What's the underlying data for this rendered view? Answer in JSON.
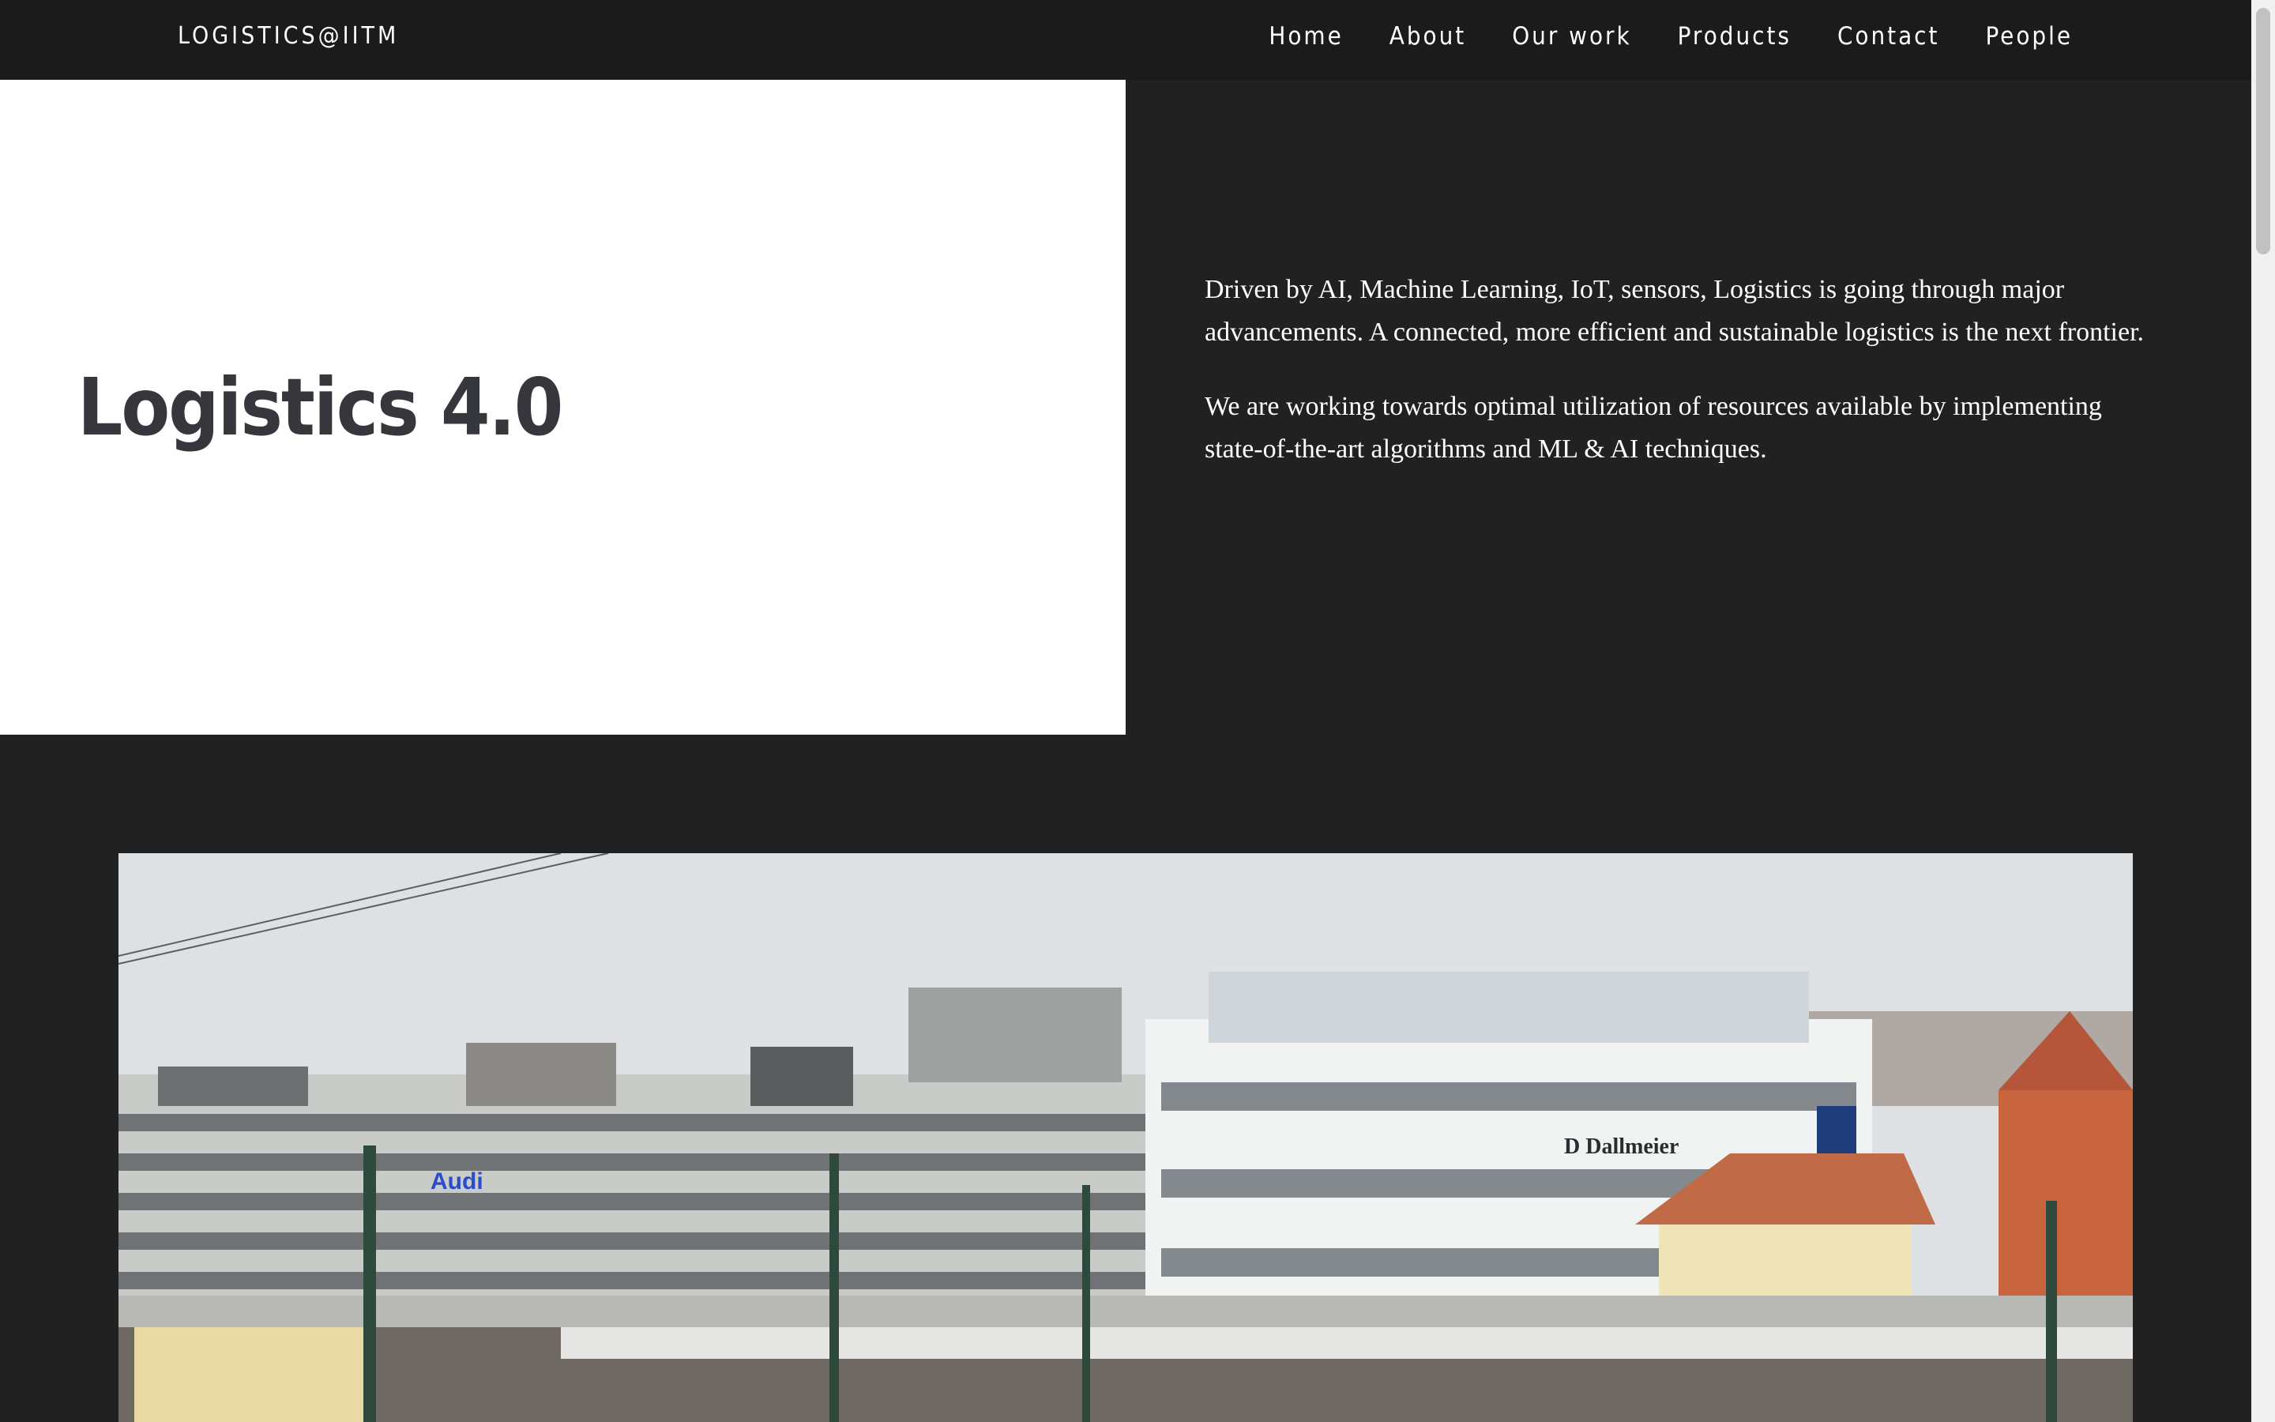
{
  "brand": "LOGISTICS@IITM",
  "nav": {
    "items": [
      "Home",
      "About",
      "Our work",
      "Products",
      "Contact",
      "People"
    ]
  },
  "hero": {
    "title": "Logistics 4.0",
    "paragraph1": "Driven by AI, Machine Learning, IoT, sensors, Logistics is going through major advancements. A connected, more efficient and sustainable logistics is the next frontier.",
    "paragraph2": "We are working towards optimal utilization of resources available by implementing state-of-the-art algorithms and ML & AI techniques."
  },
  "photo": {
    "signs": [
      "Audi",
      "D Dallmeier"
    ]
  },
  "colors": {
    "navbar_bg": "#1b1b1b",
    "page_bg": "#212121",
    "hero_left_bg": "#ffffff",
    "title_color": "#36363d",
    "text_color": "#ffffff"
  }
}
